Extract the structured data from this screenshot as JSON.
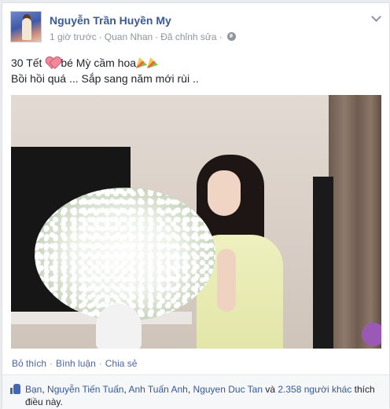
{
  "post": {
    "author": "Nguyễn Trần Huyền My",
    "time": "1 giờ trước",
    "location": "Quan Nhan",
    "edited": "Đã chỉnh sửa",
    "separator": "·",
    "text_line1_a": "30 Tết",
    "text_line1_b": "bé Mỳ cầm hoa",
    "text_line2": "Bồi hồi quá ... Sắp sang năm mới rùi .."
  },
  "actions": {
    "like": "Bỏ thích",
    "comment": "Bình luận",
    "share": "Chia sẻ",
    "separator": "·"
  },
  "likes": {
    "you": "Bạn",
    "comma": ", ",
    "names": [
      "Nguyễn Tiến Tuấn",
      "Anh Tuấn Anh",
      "Nguyen Duc Tan"
    ],
    "and_text": " và ",
    "others": "2.358 người khác",
    "suffix": " thích điều này."
  },
  "icons": {
    "avatar": "profile-photo",
    "privacy": "globe-icon",
    "menu": "chevron-down-icon",
    "emoji1": "heart-icon",
    "emoji2": "party-popper-icon",
    "like": "thumbs-up-icon"
  },
  "colors": {
    "author": "#3b5998",
    "link": "#365899",
    "meta": "#90949c",
    "like_icon": "#4267b2"
  }
}
